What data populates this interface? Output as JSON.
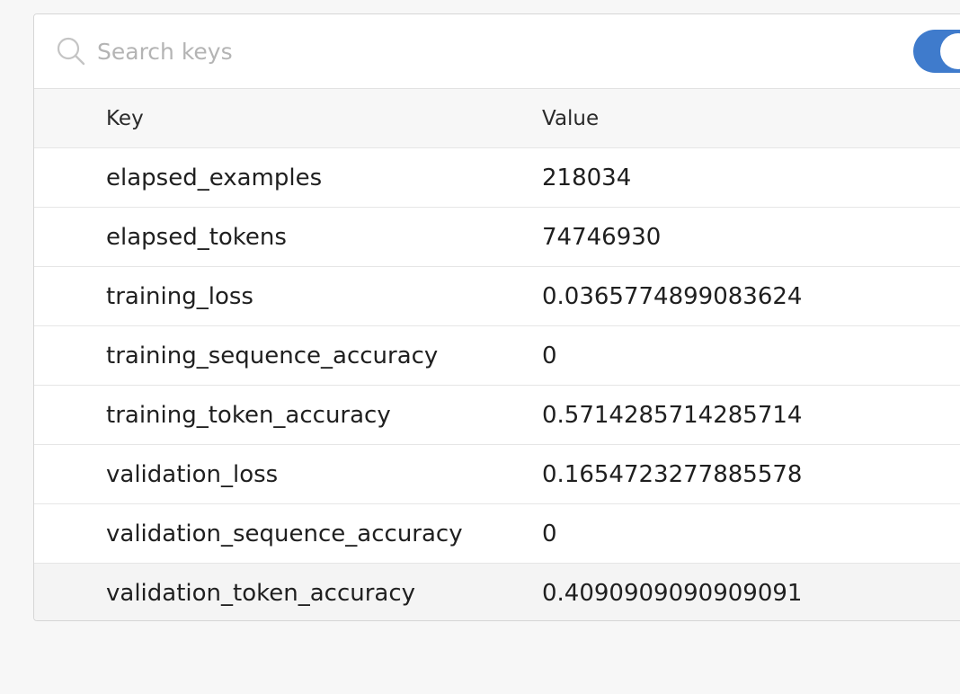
{
  "search": {
    "placeholder": "Search keys",
    "value": "",
    "icon": "search-icon"
  },
  "toggle": {
    "state": "on",
    "accent_color": "#3f7bcc"
  },
  "table": {
    "headers": {
      "key": "Key",
      "value": "Value"
    },
    "rows": [
      {
        "key": "elapsed_examples",
        "value": "218034"
      },
      {
        "key": "elapsed_tokens",
        "value": "74746930"
      },
      {
        "key": "training_loss",
        "value": "0.0365774899083624"
      },
      {
        "key": "training_sequence_accuracy",
        "value": "0"
      },
      {
        "key": "training_token_accuracy",
        "value": "0.5714285714285714"
      },
      {
        "key": "validation_loss",
        "value": "0.1654723277885578"
      },
      {
        "key": "validation_sequence_accuracy",
        "value": "0"
      },
      {
        "key": "validation_token_accuracy",
        "value": "0.4090909090909091"
      }
    ]
  }
}
